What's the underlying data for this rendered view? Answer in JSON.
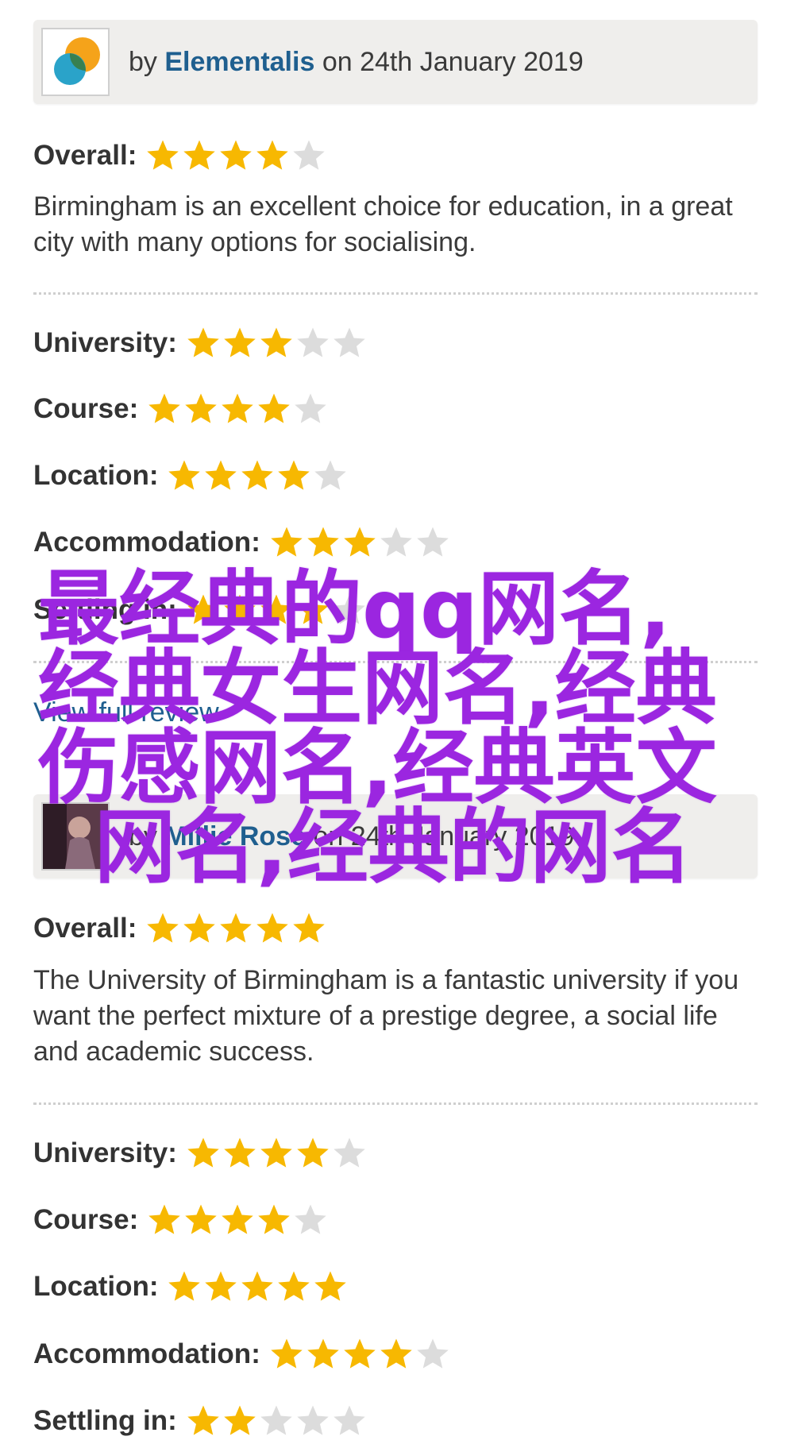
{
  "reviews": [
    {
      "by": "by",
      "author": "Elementalis",
      "on_date": "on 24th January 2019",
      "overall_label": "Overall:",
      "overall_stars": 4,
      "text": "Birmingham is an excellent choice for education, in a great city with many options for socialising.",
      "categories": [
        {
          "label": "University:",
          "stars": 3
        },
        {
          "label": "Course:",
          "stars": 4
        },
        {
          "label": "Location:",
          "stars": 4
        },
        {
          "label": "Accommodation:",
          "stars": 3
        },
        {
          "label": "Settling in:",
          "stars": 4
        }
      ],
      "link": "View full review"
    },
    {
      "by": "by",
      "author": "Millie Rose",
      "on_date": "on 24th January 2019",
      "overall_label": "Overall:",
      "overall_stars": 5,
      "text": "The University of Birmingham is a fantastic university if you want the perfect mixture of a prestige degree, a social life and academic success.",
      "categories": [
        {
          "label": "University:",
          "stars": 4
        },
        {
          "label": "Course:",
          "stars": 4
        },
        {
          "label": "Location:",
          "stars": 5
        },
        {
          "label": "Accommodation:",
          "stars": 4
        },
        {
          "label": "Settling in:",
          "stars": 2
        }
      ]
    }
  ],
  "overlay_title": "最经典的qq网名,\n经典女生网名,经典\n伤感网名,经典英文\n  网名,经典的网名",
  "colors": {
    "star_on": "#f7b801",
    "star_off": "#dcdcdc",
    "author": "#1f5f8f",
    "overlay": "#9b26e0",
    "header_bg": "#efeeec"
  }
}
